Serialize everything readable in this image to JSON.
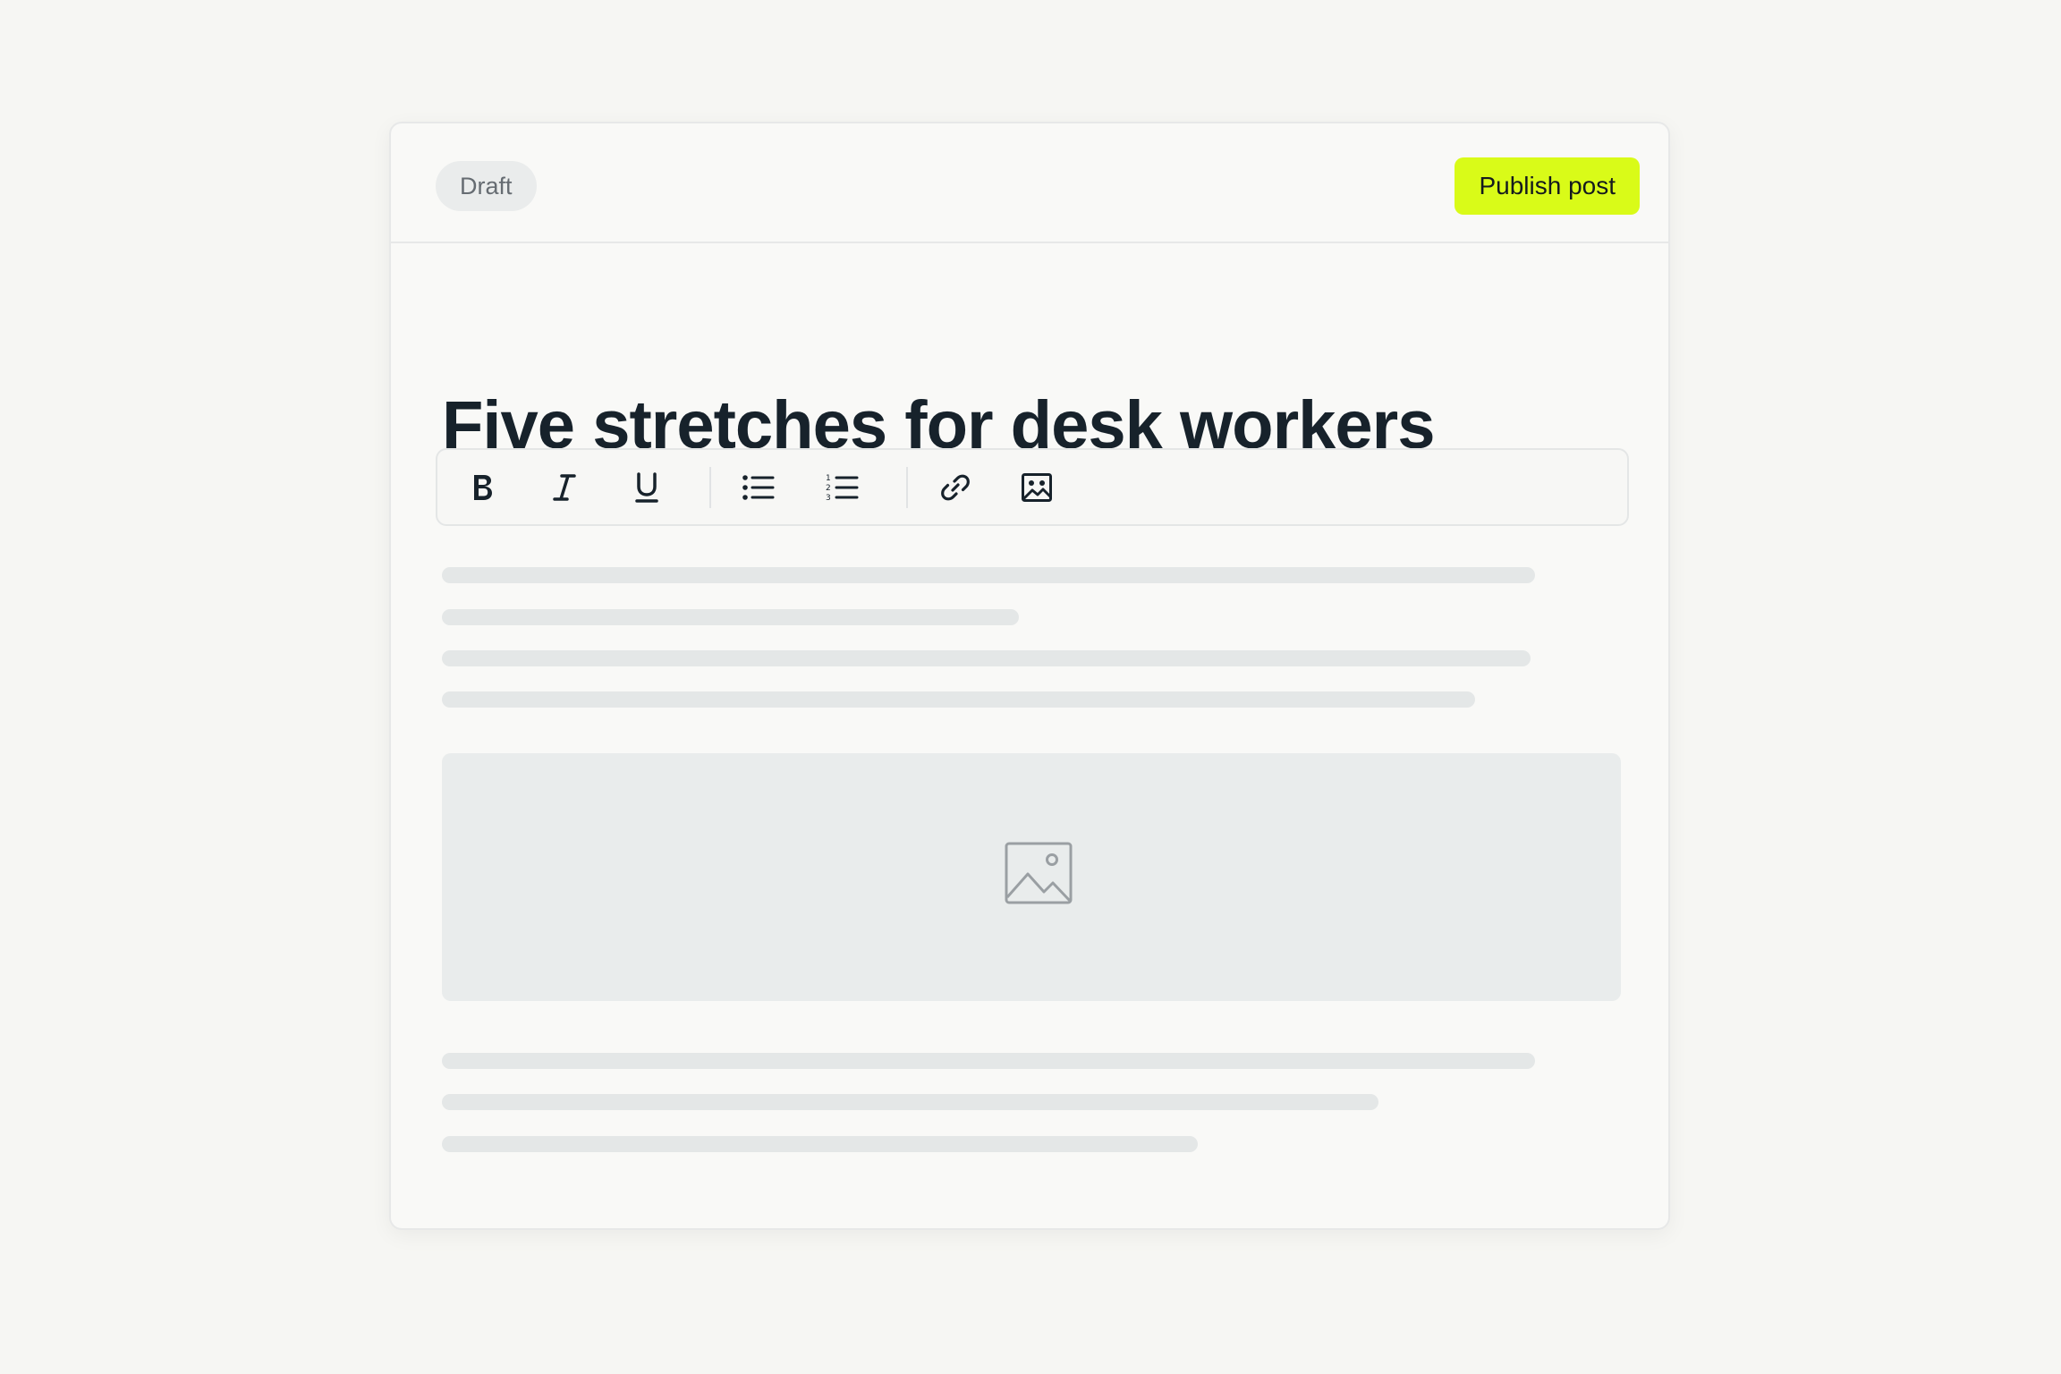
{
  "header": {
    "status_badge": "Draft",
    "publish_label": "Publish post"
  },
  "post": {
    "title": "Five stretches for desk workers"
  },
  "toolbar": {
    "tools": [
      {
        "name": "bold",
        "icon": "bold-icon"
      },
      {
        "name": "italic",
        "icon": "italic-icon"
      },
      {
        "name": "underline",
        "icon": "underline-icon"
      },
      {
        "name": "bulleted-list",
        "icon": "bulleted-list-icon"
      },
      {
        "name": "numbered-list",
        "icon": "numbered-list-icon"
      },
      {
        "name": "link",
        "icon": "link-icon"
      },
      {
        "name": "insert-image",
        "icon": "image-icon"
      }
    ]
  },
  "body": {
    "image_placeholder_icon": "image-icon"
  },
  "colors": {
    "accent": "#d9fb18",
    "title_text": "#17222b",
    "skeleton": "#e4e7e7",
    "background": "#f6f6f3"
  }
}
